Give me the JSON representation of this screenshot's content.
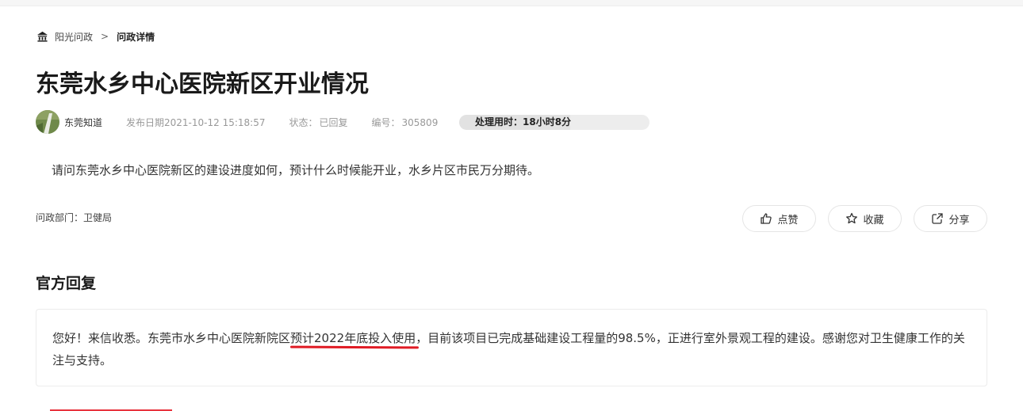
{
  "breadcrumb": {
    "home_icon": "home-icon",
    "home_label": "阳光问政",
    "separator": ">",
    "current": "问政详情"
  },
  "post": {
    "title": "东莞水乡中心医院新区开业情况",
    "author": "东莞知道",
    "publish_date": "发布日期2021-10-12 15:18:57",
    "status_label": "状态：",
    "status_value": "已回复",
    "number_label": "编号：",
    "number_value": "305809",
    "processing_time": "处理用时：18小时8分",
    "question": "请问东莞水乡中心医院新区的建设进度如何，预计什么时候能开业，水乡片区市民万分期待。",
    "department": "问政部门：卫健局"
  },
  "actions": {
    "like_label": "点赞",
    "like_icon": "thumbs-up-icon",
    "favorite_label": "收藏",
    "favorite_icon": "star-icon",
    "share_label": "分享",
    "share_icon": "share-icon"
  },
  "reply": {
    "heading": "官方回复",
    "text_before": "您好！来信收悉。东莞市水乡中心医院新院区",
    "text_highlight": "预计2022年底投入使用",
    "text_after": "，目前该项目已完成基础建设工程量的98.5%，正进行室外景观工程的建设。感谢您对卫生健康工作的关注与支持。"
  },
  "colors": {
    "accent_red": "#e01b24",
    "tab_underline": "#e8333d",
    "muted_text": "#999999",
    "border": "#ececec"
  }
}
